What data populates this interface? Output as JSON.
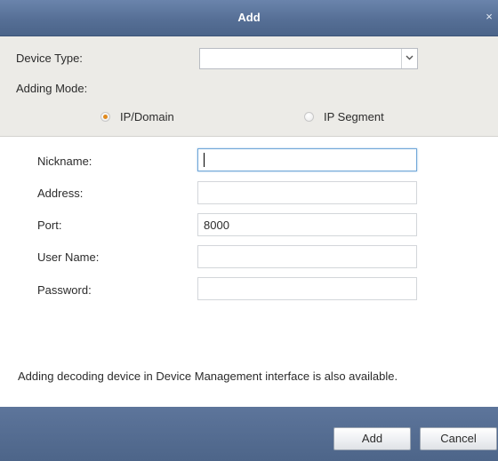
{
  "dialog": {
    "title": "Add",
    "close_glyph": "×"
  },
  "device_type": {
    "label": "Device Type:",
    "selected_value": ""
  },
  "adding_mode": {
    "label": "Adding Mode:",
    "options": [
      {
        "label": "IP/Domain",
        "checked": true
      },
      {
        "label": "IP Segment",
        "checked": false
      }
    ]
  },
  "form": {
    "nickname": {
      "label": "Nickname:",
      "value": ""
    },
    "address": {
      "label": "Address:",
      "value": ""
    },
    "port": {
      "label": "Port:",
      "value": "8000"
    },
    "user_name": {
      "label": "User Name:",
      "value": ""
    },
    "password": {
      "label": "Password:",
      "value": ""
    }
  },
  "note": "Adding decoding device in Device Management interface is also available.",
  "buttons": {
    "add": "Add",
    "cancel": "Cancel"
  },
  "colors": {
    "titlebar": "#566f96",
    "section_bg": "#ecebe7",
    "radio_selected": "#e08a1e",
    "focus_border": "#6fa6d8"
  },
  "icons": {
    "close": "close-icon",
    "dropdown": "chevron-down-icon"
  }
}
